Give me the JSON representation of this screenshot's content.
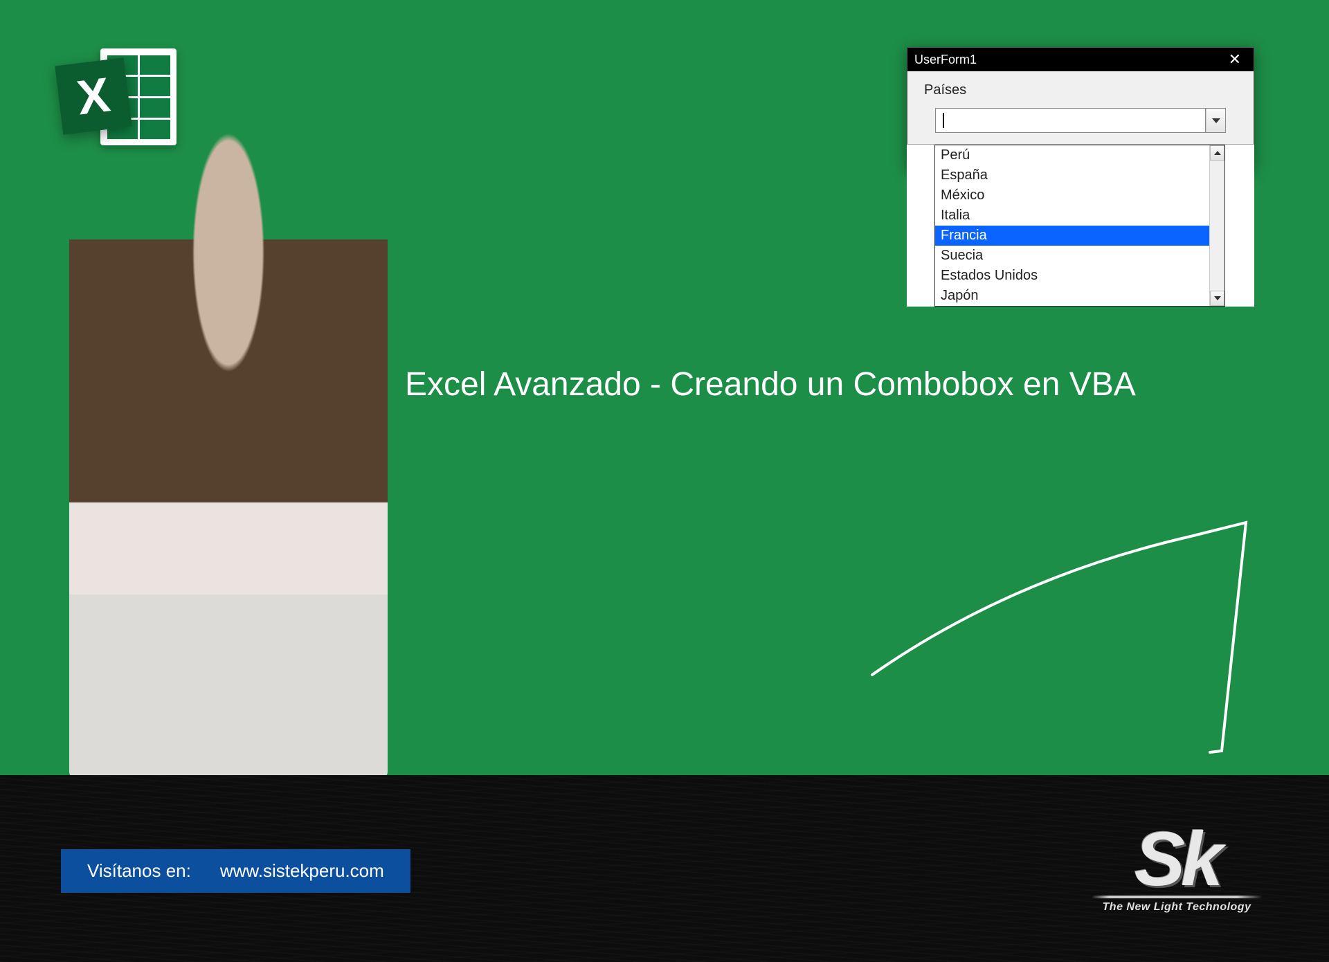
{
  "headline": "Excel Avanzado - Creando un Combobox en VBA",
  "userform": {
    "title": "UserForm1",
    "label": "Países",
    "input_value": "",
    "options": [
      "Perú",
      "España",
      "México",
      "Italia",
      "Francia",
      "Suecia",
      "Estados Unidos",
      "Japón"
    ],
    "selected_index": 4
  },
  "footer": {
    "visit_label": "Visítanos en:",
    "visit_url": "www.sistekperu.com"
  },
  "logo": {
    "text": "Sk",
    "tagline": "The New Light Technology"
  },
  "excel_logo_letter": "X"
}
